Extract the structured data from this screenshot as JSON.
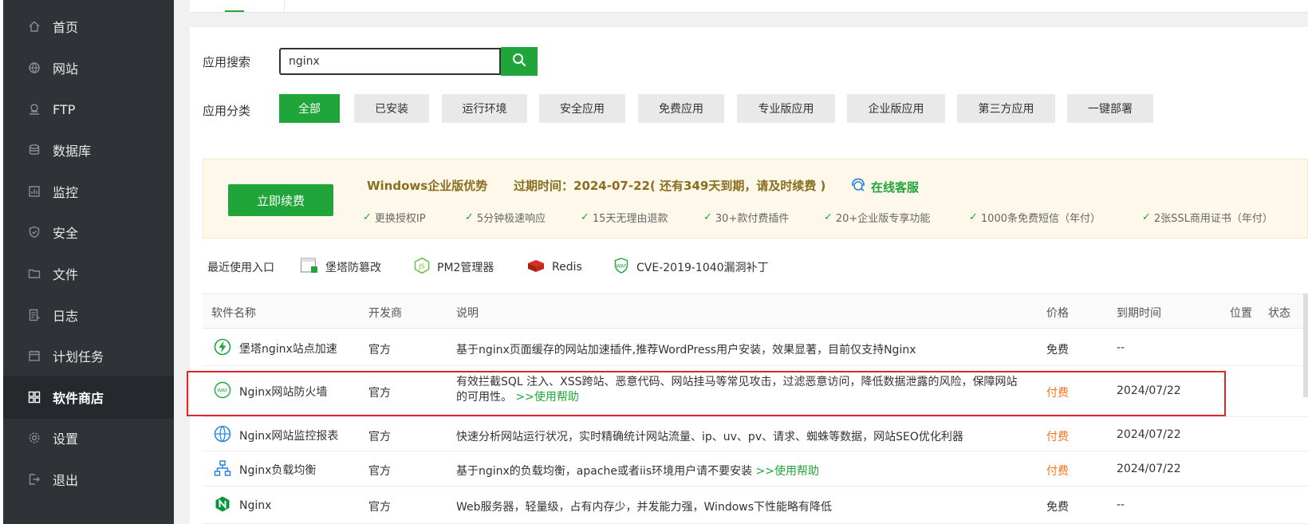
{
  "sidebar": {
    "items": [
      {
        "label": "首页",
        "icon": "home-icon"
      },
      {
        "label": "网站",
        "icon": "globe-icon"
      },
      {
        "label": "FTP",
        "icon": "ftp-icon"
      },
      {
        "label": "数据库",
        "icon": "database-icon"
      },
      {
        "label": "监控",
        "icon": "monitor-icon"
      },
      {
        "label": "安全",
        "icon": "shield-icon"
      },
      {
        "label": "文件",
        "icon": "folder-icon"
      },
      {
        "label": "日志",
        "icon": "log-icon"
      },
      {
        "label": "计划任务",
        "icon": "calendar-icon"
      },
      {
        "label": "软件商店",
        "icon": "grid-icon",
        "active": true
      },
      {
        "label": "设置",
        "icon": "gear-icon"
      },
      {
        "label": "退出",
        "icon": "logout-icon"
      }
    ]
  },
  "search": {
    "label": "应用搜索",
    "value": "nginx",
    "button_icon": "search-icon"
  },
  "categories": {
    "label": "应用分类",
    "items": [
      "全部",
      "已安装",
      "运行环境",
      "安全应用",
      "免费应用",
      "专业版应用",
      "企业版应用",
      "第三方应用",
      "一键部署"
    ],
    "active": "全部"
  },
  "promo": {
    "renew_label": "立即续费",
    "title": "Windows企业版优势",
    "expiry": "过期时间：2024-07-22( 还有349天到期，请及时续费 )",
    "service": "在线客服",
    "features": [
      "更换授权IP",
      "5分钟极速响应",
      "15天无理由退款",
      "30+款付费插件",
      "20+企业版专享功能",
      "1000条免费短信（年付）",
      "2张SSL商用证书（年付）"
    ]
  },
  "recent": {
    "label": "最近使用入口",
    "items": [
      {
        "label": "堡塔防篡改",
        "icon": "tamper-icon"
      },
      {
        "label": "PM2管理器",
        "icon": "nodejs-icon"
      },
      {
        "label": "Redis",
        "icon": "redis-icon"
      },
      {
        "label": "CVE-2019-1040漏洞补丁",
        "icon": "waf-icon"
      }
    ]
  },
  "table": {
    "headers": [
      "软件名称",
      "开发商",
      "说明",
      "价格",
      "到期时间",
      "位置",
      "状态"
    ],
    "rows": [
      {
        "name": "堡塔nginx站点加速",
        "icon": "lightning-icon",
        "dev": "官方",
        "desc": "基于nginx页面缓存的网站加速插件,推荐WordPress用户安装，效果显著，目前仅支持Nginx",
        "help": "",
        "price": "免费",
        "expire": "--"
      },
      {
        "name": "Nginx网站防火墙",
        "icon": "waf-icon",
        "dev": "官方",
        "desc": "有效拦截SQL 注入、XSS跨站、恶意代码、网站挂马等常见攻击，过滤恶意访问，降低数据泄露的风险，保障网站的可用性。",
        "help": ">>使用帮助",
        "price": "付费",
        "expire": "2024/07/22"
      },
      {
        "name": "Nginx网站监控报表",
        "icon": "globe-monitor-icon",
        "dev": "官方",
        "desc": "快速分析网站运行状况，实时精确统计网站流量、ip、uv、pv、请求、蜘蛛等数据，网站SEO优化利器",
        "help": "",
        "price": "付费",
        "expire": "2024/07/22"
      },
      {
        "name": "Nginx负载均衡",
        "icon": "network-icon",
        "dev": "官方",
        "desc": "基于nginx的负载均衡，apache或者iis环境用户请不要安装",
        "help": ">>使用帮助",
        "price": "付费",
        "expire": "2024/07/22"
      },
      {
        "name": "Nginx",
        "icon": "nginx-icon",
        "dev": "官方",
        "desc": "Web服务器，轻量级，占有内存少，并发能力强，Windows下性能略有降低",
        "help": "",
        "price": "免费",
        "expire": "--"
      }
    ]
  },
  "colors": {
    "accent": "#20a53a",
    "paid": "#f0761e",
    "highlight": "#e0262b",
    "sidebar": "#2f3338"
  }
}
